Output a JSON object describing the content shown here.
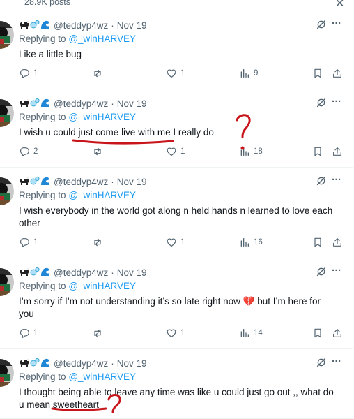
{
  "header": {
    "posts_count": "28.9K posts"
  },
  "tweets": [
    {
      "handle": "@teddyp4wz",
      "sep": "·",
      "date": "Nov 19",
      "replying_prefix": "Replying to",
      "replying_to": "@_winHARVEY",
      "text_lines": [
        "Like a little bug"
      ],
      "stats": {
        "replies": "1",
        "reposts": "",
        "likes": "1",
        "views": "9"
      }
    },
    {
      "handle": "@teddyp4wz",
      "sep": "·",
      "date": "Nov 19",
      "replying_prefix": "Replying to",
      "replying_to": "@_winHARVEY",
      "text_lines": [
        "I wish u could just come live with me I really do"
      ],
      "stats": {
        "replies": "2",
        "reposts": "",
        "likes": "1",
        "views": "18"
      }
    },
    {
      "handle": "@teddyp4wz",
      "sep": "·",
      "date": "Nov 19",
      "replying_prefix": "Replying to",
      "replying_to": "@_winHARVEY",
      "text_lines": [
        "I wish everybody in the world got along n held hands n learned to love each",
        "other"
      ],
      "stats": {
        "replies": "1",
        "reposts": "",
        "likes": "1",
        "views": "16"
      }
    },
    {
      "handle": "@teddyp4wz",
      "sep": "·",
      "date": "Nov 19",
      "replying_prefix": "Replying to",
      "replying_to": "@_winHARVEY",
      "text_lines": [
        "I’m sorry if I’m not understanding it’s so late right now 💔 but I’m here for",
        "you"
      ],
      "stats": {
        "replies": "1",
        "reposts": "",
        "likes": "1",
        "views": "14"
      }
    },
    {
      "handle": "@teddyp4wz",
      "sep": "·",
      "date": "Nov 19",
      "replying_prefix": "Replying to",
      "replying_to": "@_winHARVEY",
      "text_lines": [
        "I thought being able to leave any time was like u could just go out ,, what do",
        "u mean sweetheart"
      ],
      "stats": {
        "replies": "",
        "reposts": "",
        "likes": "",
        "views": ""
      }
    }
  ],
  "icons": {
    "name_emojis": [
      "cow-icon",
      "bubbles-icon",
      "wave-icon"
    ],
    "actions": [
      "reply-icon",
      "repost-icon",
      "like-icon",
      "views-icon",
      "bookmark-icon",
      "share-icon"
    ],
    "grok": "grok-icon",
    "more": "more-icon"
  },
  "colors": {
    "text": "#0f1419",
    "muted": "#536471",
    "link": "#1d9bf0",
    "annotation": "#c8151b"
  }
}
